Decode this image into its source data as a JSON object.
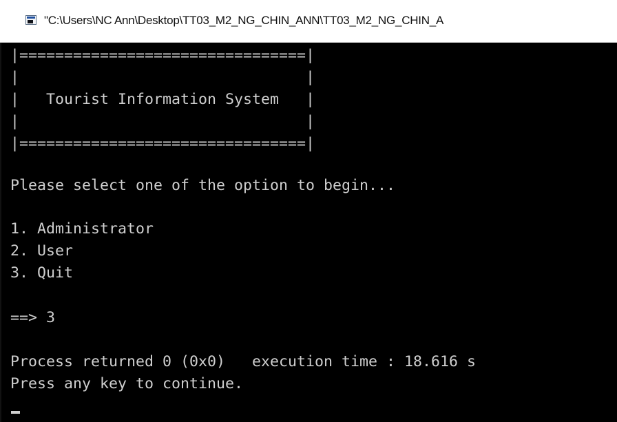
{
  "window": {
    "title": "\"C:\\Users\\NC Ann\\Desktop\\TT03_M2_NG_CHIN_ANN\\TT03_M2_NG_CHIN_A"
  },
  "console": {
    "lines": [
      "|================================|",
      "|                                |",
      "|   Tourist Information System   |",
      "|                                |",
      "|================================|",
      "",
      "Please select one of the option to begin...",
      "",
      "1. Administrator",
      "2. User",
      "3. Quit",
      "",
      "==> 3",
      "",
      "Process returned 0 (0x0)   execution time : 18.616 s",
      "Press any key to continue."
    ]
  },
  "icons": {
    "window_icon": "console-app-icon",
    "cursor": "text-cursor"
  },
  "colors": {
    "console_background": "#000000",
    "console_text": "#cfcfcf",
    "titlebar_background": "#ffffff",
    "titlebar_text": "#111111"
  }
}
